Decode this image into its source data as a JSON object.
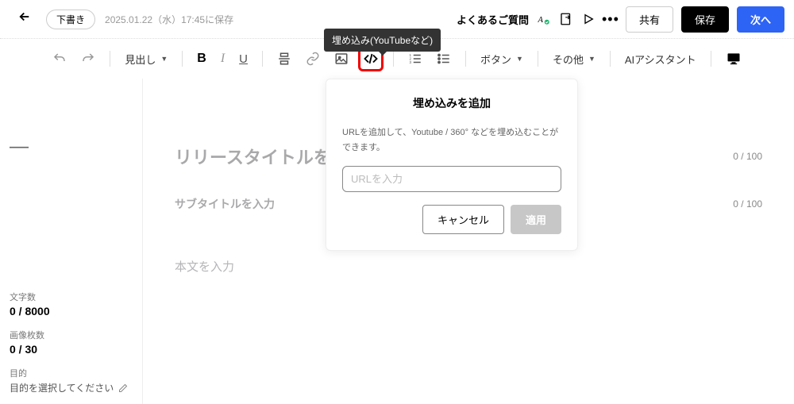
{
  "header": {
    "draft_chip": "下書き",
    "saved_at": "2025.01.22（水）17:45に保存",
    "faq": "よくあるご質問",
    "share_btn": "共有",
    "save_btn": "保存",
    "next_btn": "次へ"
  },
  "toolbar": {
    "heading": "見出し",
    "button_label": "ボタン",
    "other_label": "その他",
    "assistant": "AIアシスタント"
  },
  "tooltip": {
    "embed": "埋め込み(YouTubeなど)"
  },
  "sidebar": {
    "char_label": "文字数",
    "char_value": "0 / 8000",
    "img_label": "画像枚数",
    "img_value": "0 / 30",
    "purpose_label": "目的",
    "purpose_value": "目的を選択してください"
  },
  "editor": {
    "title_placeholder": "リリースタイトルを入力",
    "title_counter": "0 / 100",
    "subtitle_placeholder": "サブタイトルを入力",
    "subtitle_counter": "0 / 100",
    "body_placeholder": "本文を入力"
  },
  "popover": {
    "title": "埋め込みを追加",
    "desc": "URLを追加して、Youtube / 360° などを埋め込むことができます。",
    "input_placeholder": "URLを入力",
    "cancel": "キャンセル",
    "apply": "適用"
  }
}
